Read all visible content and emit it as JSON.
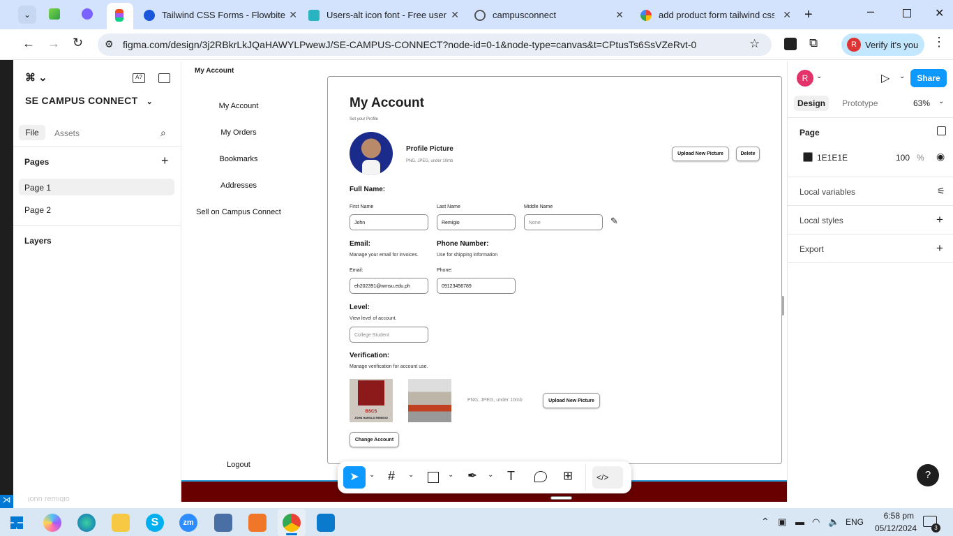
{
  "browser": {
    "tabs": [
      {
        "title": "Tailwind CSS Forms - Flowbite"
      },
      {
        "title": "Users-alt icon font - Free user ic"
      },
      {
        "title": "campusconnect"
      },
      {
        "title": "add product form tailwind css -"
      }
    ],
    "url": "figma.com/design/3j2RBkrLkJQaHAWYLPwewJ/SE-CAMPUS-CONNECT?node-id=0-1&node-type=canvas&t=CPtusTs6SsVZeRvt-0",
    "verify_label": "Verify it's you",
    "profile_initial": "R"
  },
  "figma": {
    "project_name": "SE CAMPUS CONNECT",
    "tabs": {
      "file": "File",
      "assets": "Assets"
    },
    "pages_heading": "Pages",
    "pages": [
      "Page 1",
      "Page 2"
    ],
    "layers_heading": "Layers",
    "frame_label": "My Account",
    "right": {
      "avatar": "R",
      "share": "Share",
      "design_tab": "Design",
      "prototype_tab": "Prototype",
      "zoom": "63%",
      "page_heading": "Page",
      "bg_hex": "1E1E1E",
      "bg_opacity": "100",
      "percent": "%",
      "local_variables": "Local variables",
      "local_styles": "Local styles",
      "export": "Export"
    }
  },
  "design": {
    "nav": [
      "My Account",
      "My Orders",
      "Bookmarks",
      "Addresses",
      "Sell on Campus Connect"
    ],
    "logout": "Logout",
    "title": "My Account",
    "subtitle": "Set your Profile",
    "profile_picture_label": "Profile Picture",
    "profile_picture_hint": "PNG, JPEG, under 10mb",
    "upload_button": "Upload New Picture",
    "delete_button": "Delete",
    "full_name_heading": "Full Name:",
    "first_name_label": "First Name",
    "first_name_value": "John",
    "last_name_label": "Last Name",
    "last_name_value": "Remigio",
    "middle_name_label": "Middle Name",
    "middle_name_placeholder": "None",
    "email_heading": "Email:",
    "email_sub": "Manage your email for invoices.",
    "email_label": "Email:",
    "email_value": "eh202391@wmsu.edu.ph",
    "phone_heading": "Phone Number:",
    "phone_sub": "Use for shipping information",
    "phone_label": "Phone:",
    "phone_value": "09123456789",
    "level_heading": "Level:",
    "level_sub": "View level of account.",
    "level_placeholder": "College Student",
    "verification_heading": "Verification:",
    "verification_sub": "Manage verification for account use.",
    "verification_hint": "PNG, JPEG, under 10mb",
    "verification_upload": "Upload New Picture",
    "change_account": "Change Account",
    "id_card_course": "BSCS",
    "id_card_name": "JOHN HAROLD REMIGIO"
  },
  "status_bar": {
    "user": "john remigio"
  },
  "taskbar": {
    "lang": "ENG",
    "time": "6:58 pm",
    "date": "05/12/2024",
    "notifications": "3"
  }
}
